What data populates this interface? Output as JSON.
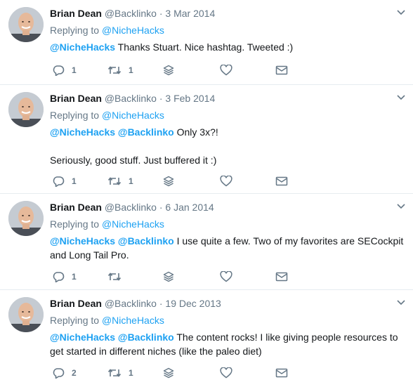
{
  "tweets": [
    {
      "name": "Brian Dean",
      "handle": "@Backlinko",
      "separator": "·",
      "date": "3 Mar 2014",
      "replying_prefix": "Replying to",
      "replying_to": "@NicheHacks",
      "mention_1": "@NicheHacks",
      "line_1": " Thanks Stuart. Nice hashtag. Tweeted :)",
      "reply_count": "1",
      "retweet_count": "1"
    },
    {
      "name": "Brian Dean",
      "handle": "@Backlinko",
      "separator": "·",
      "date": "3 Feb 2014",
      "replying_prefix": "Replying to",
      "replying_to": "@NicheHacks",
      "mention_1": "@NicheHacks",
      "mention_2": "@Backlinko",
      "line_1": " Only 3x?!",
      "line_2": "Seriously, good stuff. Just buffered it :)",
      "reply_count": "1",
      "retweet_count": "1"
    },
    {
      "name": "Brian Dean",
      "handle": "@Backlinko",
      "separator": "·",
      "date": "6 Jan 2014",
      "replying_prefix": "Replying to",
      "replying_to": "@NicheHacks",
      "mention_1": "@NicheHacks",
      "mention_2": "@Backlinko",
      "line_1": " I use quite a few. Two of my favorites are SECockpit",
      "line_2": "and Long Tail Pro.",
      "reply_count": "1",
      "retweet_count": ""
    },
    {
      "name": "Brian Dean",
      "handle": "@Backlinko",
      "separator": "·",
      "date": "19 Dec 2013",
      "replying_prefix": "Replying to",
      "replying_to": "@NicheHacks",
      "mention_1": "@NicheHacks",
      "mention_2": "@Backlinko",
      "line_1": " The content rocks! I like giving people resources to",
      "line_2": "get started in different niches (like the paleo diet)",
      "reply_count": "2",
      "retweet_count": "1"
    }
  ],
  "icons": {
    "reply": "reply-icon",
    "retweet": "retweet-icon",
    "stack": "stack-icon",
    "like": "heart-icon",
    "dm": "envelope-icon",
    "caret": "chevron-down-icon"
  },
  "colors": {
    "link": "#1da1f2",
    "muted": "#657786",
    "text": "#14171a",
    "divider": "#e6ecf0"
  }
}
